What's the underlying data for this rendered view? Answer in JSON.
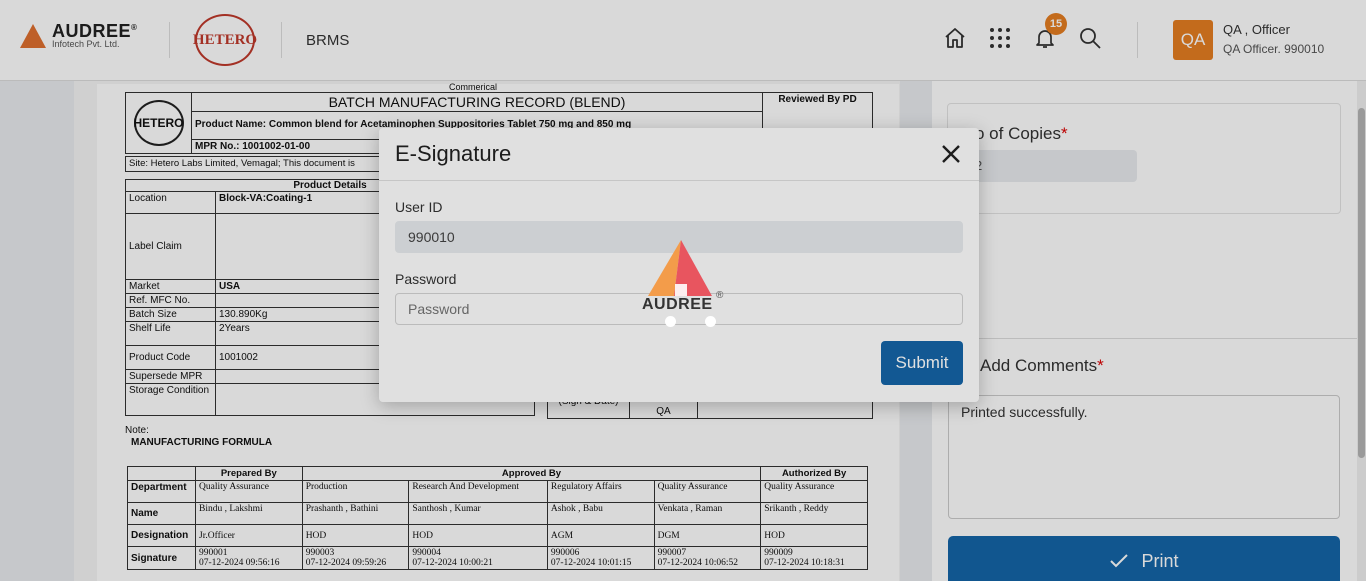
{
  "header": {
    "logo_text": "AUDREE",
    "logo_sub": "Infotech Pvt. Ltd.",
    "logo_reg": "®",
    "client_logo": "HETERO",
    "app_name": "BRMS",
    "notification_count": "15",
    "avatar": "QA",
    "user_name": "QA , Officer",
    "user_role": "QA Officer. 990010",
    "icons": [
      "home-icon",
      "apps-grid-icon",
      "bell-icon",
      "search-icon"
    ]
  },
  "document": {
    "commercial": "Commerical",
    "logo": "HETERO",
    "title": "BATCH MANUFACTURING RECORD (BLEND)",
    "reviewed_by": "Reviewed By PD",
    "product_name": "Product Name: Common blend for Acetaminophen Suppositories Tablet 750 mg and 850 mg",
    "mpr_no": "MPR No.: 1001002-01-00",
    "site": "Site: Hetero Labs Limited, Vemagal; This document is",
    "product_details_title": "Product Details",
    "product_details": [
      {
        "label": "Location",
        "value": "Block-VA:Coating-1"
      },
      {
        "label": "Label Claim",
        "value": ""
      },
      {
        "label": "Market",
        "value": "USA"
      },
      {
        "label": "Ref. MFC No.",
        "value": ""
      },
      {
        "label": "Batch Size",
        "value": "130.890Kg"
      },
      {
        "label": "Shelf Life",
        "value": "2Years"
      },
      {
        "label": "Product Code",
        "value": "1001002"
      },
      {
        "label": "Supersede MPR",
        "value": ""
      },
      {
        "label": "Storage Condition",
        "value": ""
      }
    ],
    "sign_date": "(Sign & Date)",
    "qa": "QA",
    "note": "Note:",
    "manufacturing_formula": "MANUFACTURING FORMULA",
    "approval": {
      "headers": {
        "prepared": "Prepared By",
        "approved": "Approved By",
        "authorized": "Authorized By"
      },
      "row_labels": {
        "department": "Department",
        "name": "Name",
        "designation": "Designation",
        "signature": "Signature"
      },
      "columns": [
        {
          "department": "Quality Assurance",
          "name": "Bindu , Lakshmi",
          "designation": "Jr.Officer",
          "sig_id": "990001",
          "sig_time": "07-12-2024 09:56:16"
        },
        {
          "department": "Production",
          "name": "Prashanth , Bathini",
          "designation": "HOD",
          "sig_id": "990003",
          "sig_time": "07-12-2024 09:59:26"
        },
        {
          "department": "Research And Development",
          "name": "Santhosh , Kumar",
          "designation": "HOD",
          "sig_id": "990004",
          "sig_time": "07-12-2024 10:00:21"
        },
        {
          "department": "Regulatory Affairs",
          "name": "Ashok , Babu",
          "designation": "AGM",
          "sig_id": "990006",
          "sig_time": "07-12-2024 10:01:15"
        },
        {
          "department": "Quality Assurance",
          "name": "Venkata , Raman",
          "designation": "DGM",
          "sig_id": "990007",
          "sig_time": "07-12-2024 10:06:52"
        },
        {
          "department": "Quality Assurance",
          "name": "Srikanth , Reddy",
          "designation": "HOD",
          "sig_id": "990009",
          "sig_time": "07-12-2024 10:18:31"
        }
      ]
    }
  },
  "panel": {
    "copies_label": "o of Copies",
    "copies_value": "2",
    "required_mark": "*",
    "comments_label": "Add Comments",
    "comments_value": "Printed successfully.",
    "print_label": "Print"
  },
  "modal": {
    "title": "E-Signature",
    "user_id_label": "User ID",
    "user_id_value": "990010",
    "password_label": "Password",
    "password_placeholder": "Password",
    "submit_label": "Submit"
  },
  "loader": {
    "text": "AUDREE",
    "reg": "®"
  },
  "colors": {
    "accent": "#1565a8",
    "brand_orange": "#e67e22",
    "hetero_red": "#c0392b"
  }
}
